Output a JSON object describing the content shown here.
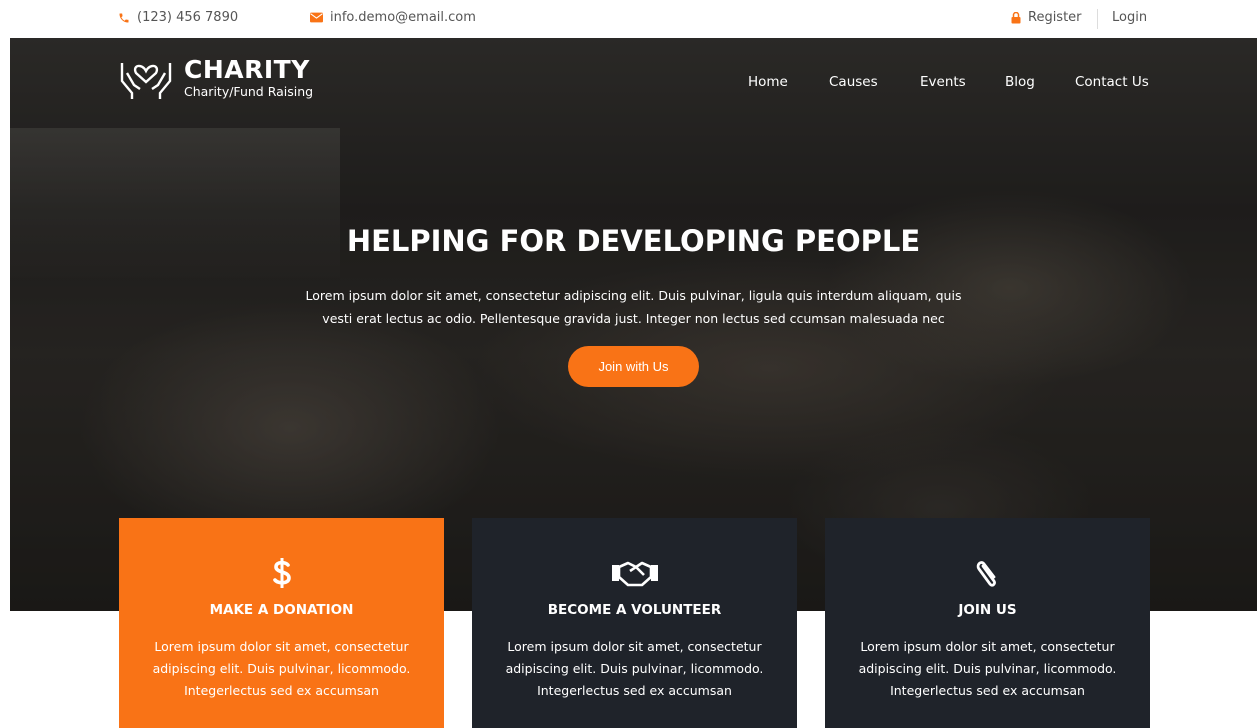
{
  "topbar": {
    "phone": "(123) 456 7890",
    "email": "info.demo@email.com",
    "register": "Register",
    "login": "Login"
  },
  "brand": {
    "name": "CHARITY",
    "tagline": "Charity/Fund Raising"
  },
  "nav": [
    "Home",
    "Causes",
    "Events",
    "Blog",
    "Contact Us"
  ],
  "hero": {
    "headline": "HELPING FOR DEVELOPING PEOPLE",
    "line1": "Lorem ipsum dolor sit amet, consectetur adipiscing elit. Duis pulvinar, ligula quis interdum aliquam, quis",
    "line2": "vesti erat lectus ac odio. Pellentesque gravida just. Integer non lectus sed ccumsan malesuada nec",
    "cta": "Join with Us"
  },
  "cards": [
    {
      "icon": "dollar-icon",
      "title": "MAKE A DONATION",
      "line1": "Lorem ipsum dolor sit amet, consectetur",
      "line2": "adipiscing elit. Duis pulvinar, licommodo.",
      "line3": "Integerlectus sed ex accumsan"
    },
    {
      "icon": "handshake-icon",
      "title": "BECOME A VOLUNTEER",
      "line1": "Lorem ipsum dolor sit amet, consectetur",
      "line2": "adipiscing elit. Duis pulvinar, licommodo.",
      "line3": "Integerlectus sed ex accumsan"
    },
    {
      "icon": "paperclip-icon",
      "title": "JOIN US",
      "line1": "Lorem ipsum dolor sit amet, consectetur",
      "line2": "adipiscing elit. Duis pulvinar, licommodo.",
      "line3": "Integerlectus sed ex accumsan"
    }
  ],
  "colors": {
    "accent": "#f97316",
    "dark_card": "#1f232a"
  }
}
